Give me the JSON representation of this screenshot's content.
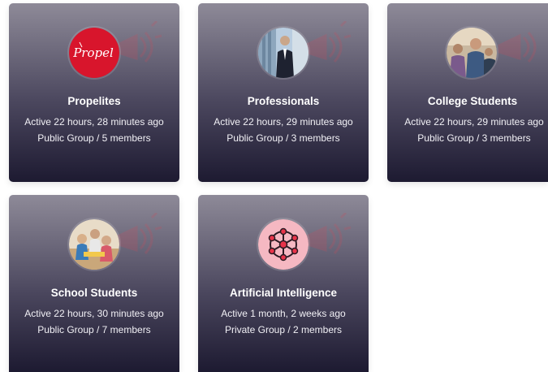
{
  "groups": [
    {
      "name": "Propelites",
      "activity": "Active 22 hours, 28 minutes ago",
      "info": "Public Group / 5 members",
      "avatar_text": "Propel",
      "avatar_color": "#d8152c"
    },
    {
      "name": "Professionals",
      "activity": "Active 22 hours, 29 minutes ago",
      "info": "Public Group / 3 members"
    },
    {
      "name": "College Students",
      "activity": "Active 22 hours, 29 minutes ago",
      "info": "Public Group / 3 members"
    },
    {
      "name": "School Students",
      "activity": "Active 22 hours, 30 minutes ago",
      "info": "Public Group / 7 members"
    },
    {
      "name": "Artificial Intelligence",
      "activity": "Active 1 month, 2 weeks ago",
      "info": "Private Group / 2 members",
      "avatar_color": "#f5b8c2"
    }
  ],
  "colors": {
    "card_gradient_top": "#8e8a98",
    "card_gradient_bottom": "#1d1a31",
    "text": "#ffffff"
  }
}
